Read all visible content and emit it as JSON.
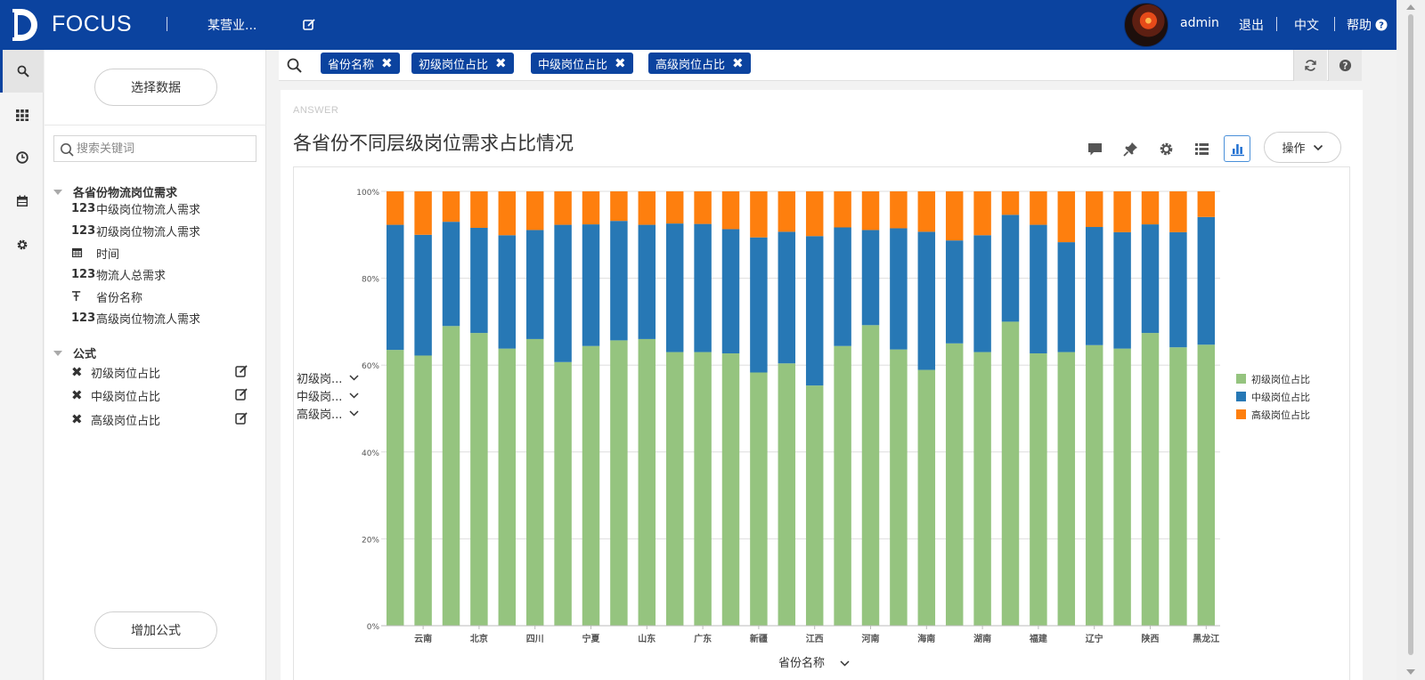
{
  "app": {
    "brand": "FOCUS",
    "workspace": "某营业...",
    "user": "admin",
    "logout": "退出",
    "language": "中文",
    "help": "帮助"
  },
  "rail": {
    "items": [
      "search-icon",
      "apps-grid-icon",
      "history-clock-icon",
      "calendar-icon",
      "settings-gear-icon"
    ],
    "active": "search-icon"
  },
  "panel": {
    "select_data": "选择数据",
    "search_placeholder": "搜索关键词",
    "group_title": "各省份物流岗位需求",
    "fields": [
      {
        "type": "123",
        "name": "中级岗位物流人需求"
      },
      {
        "type": "123",
        "name": "初级岗位物流人需求"
      },
      {
        "type": "date",
        "name": "时间"
      },
      {
        "type": "123",
        "name": "物流人总需求"
      },
      {
        "type": "text",
        "name": "省份名称"
      },
      {
        "type": "123",
        "name": "高级岗位物流人需求"
      }
    ],
    "formula_title": "公式",
    "formulas": [
      "初级岗位占比",
      "中级岗位占比",
      "高级岗位占比"
    ],
    "add_formula": "增加公式"
  },
  "search": {
    "chips": [
      "省份名称",
      "初级岗位占比",
      "中级岗位占比",
      "高级岗位占比"
    ]
  },
  "answer": {
    "label": "ANSWER",
    "title": "各省份不同层级岗位需求占比情况",
    "operate": "操作"
  },
  "colors": {
    "primary": "#0b439f",
    "junior": "#95c47f",
    "middle": "#2778b5",
    "senior": "#fe7f0e"
  },
  "chart_data": {
    "type": "bar",
    "stacked": true,
    "y_ticks": [
      "0%",
      "20%",
      "40%",
      "60%",
      "80%",
      "100%"
    ],
    "ylim": [
      0,
      100
    ],
    "xlabel": "省份名称",
    "x_tick_labels": [
      "云南",
      "北京",
      "四川",
      "宁夏",
      "山东",
      "广东",
      "新疆",
      "江西",
      "河南",
      "海南",
      "湖南",
      "福建",
      "辽宁",
      "陕西",
      "黑龙江"
    ],
    "y_series_selectors": [
      "初级岗...",
      "中级岗...",
      "高级岗..."
    ],
    "legend_position": "right",
    "grid": true,
    "series": [
      {
        "name": "初级岗位占比",
        "color": "#95c47f",
        "values": [
          63.5,
          62.2,
          69.0,
          67.4,
          63.8,
          66.0,
          60.7,
          64.4,
          65.7,
          66.0,
          63.0,
          63.0,
          62.7,
          58.3,
          60.4,
          55.3,
          64.4,
          69.2,
          63.6,
          58.9,
          65.0,
          63.0,
          70.0,
          62.7,
          63.0,
          64.6,
          63.8,
          67.4,
          64.1,
          64.7
        ]
      },
      {
        "name": "中级岗位占比",
        "color": "#2778b5",
        "values": [
          28.8,
          27.8,
          24.0,
          24.2,
          26.1,
          25.1,
          31.6,
          28.0,
          27.5,
          26.3,
          29.6,
          29.5,
          28.6,
          31.1,
          30.3,
          34.4,
          27.3,
          21.9,
          27.9,
          31.8,
          23.7,
          26.9,
          24.6,
          29.6,
          25.3,
          27.2,
          26.8,
          25.0,
          26.5,
          29.4
        ]
      },
      {
        "name": "高级岗位占比",
        "color": "#fe7f0e",
        "values": [
          7.7,
          10.0,
          7.0,
          8.4,
          10.1,
          8.9,
          7.7,
          7.6,
          6.8,
          7.7,
          7.4,
          7.5,
          8.7,
          10.6,
          9.3,
          10.3,
          8.3,
          8.9,
          8.5,
          9.3,
          11.3,
          10.1,
          5.4,
          7.7,
          11.7,
          8.2,
          9.4,
          7.6,
          9.4,
          5.9
        ]
      }
    ]
  }
}
